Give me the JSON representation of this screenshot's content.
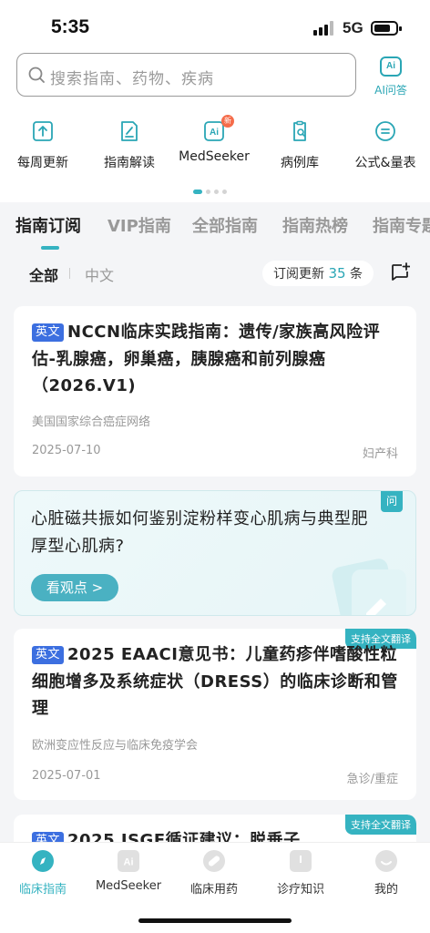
{
  "status_bar": {
    "time": "5:35",
    "network": "5G"
  },
  "search": {
    "placeholder": "搜索指南、药物、疾病"
  },
  "ai_ask": {
    "icon_text": "Ai",
    "label": "AI问答"
  },
  "quick_nav": [
    {
      "label": "每周更新",
      "icon": "upload-icon"
    },
    {
      "label": "指南解读",
      "icon": "document-pen-icon"
    },
    {
      "label": "MedSeeker",
      "icon": "ai-icon",
      "badge": "新"
    },
    {
      "label": "病例库",
      "icon": "clipboard-search-icon"
    },
    {
      "label": "公式&量表",
      "icon": "equals-icon"
    }
  ],
  "tabs": [
    "指南订阅",
    "VIP指南",
    "全部指南",
    "指南热榜",
    "指南专题"
  ],
  "filters": {
    "all": "全部",
    "chinese": "中文",
    "subscription_prefix": "订阅更新",
    "subscription_count": "35",
    "subscription_suffix": "条"
  },
  "cards": [
    {
      "lang": "英文",
      "title": "NCCN临床实践指南：遗传/家族高风险评估-乳腺癌，卵巢癌，胰腺癌和前列腺癌（2026.V1)",
      "source": "美国国家综合癌症网络",
      "date": "2025-07-10",
      "dept": "妇产科"
    },
    {
      "lang": "英文",
      "title": "2025 EAACI意见书：儿童药疹伴嗜酸性粒细胞增多及系统症状（DRESS）的临床诊断和管理",
      "source": "欧洲变应性反应与临床免疫学会",
      "date": "2025-07-01",
      "dept": "急诊/重症",
      "badge": "支持全文翻译"
    },
    {
      "lang": "英文",
      "title": "2025 ISGE循证建议：脱垂子",
      "badge": "支持全文翻译"
    }
  ],
  "qa_card": {
    "badge": "问",
    "title": "心脏磁共振如何鉴别淀粉样变心肌病与典型肥厚型心肌病?",
    "button": "看观点 >"
  },
  "bottom_nav": [
    {
      "label": "临床指南",
      "active": true
    },
    {
      "label": "MedSeeker",
      "active": false
    },
    {
      "label": "临床用药",
      "active": false
    },
    {
      "label": "诊疗知识",
      "active": false
    },
    {
      "label": "我的",
      "active": false
    }
  ],
  "colors": {
    "accent": "#35b3c1",
    "lang_tag": "#3c6fe0"
  }
}
